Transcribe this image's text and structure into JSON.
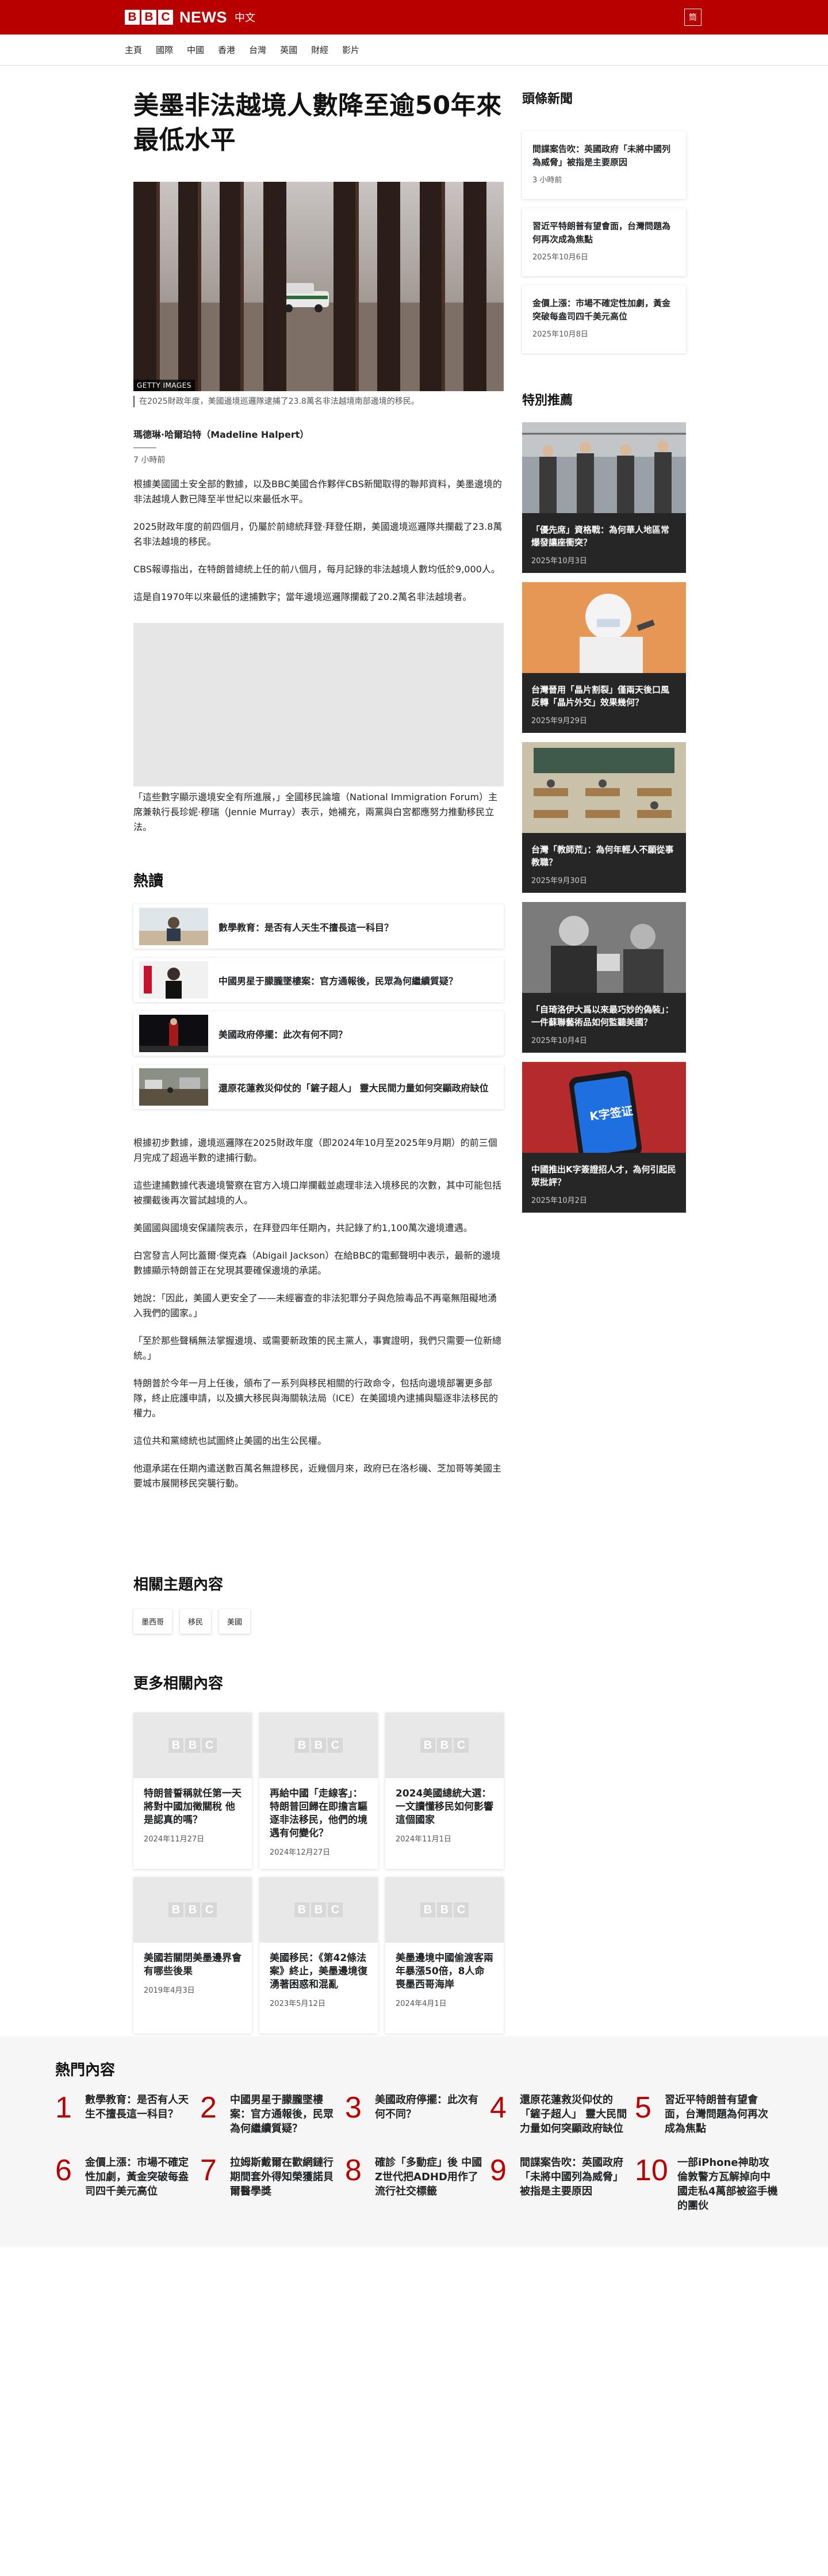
{
  "header": {
    "logo_letters": [
      "B",
      "B",
      "C"
    ],
    "logo_news": "NEWS",
    "language": "中文",
    "menu_label": "筒"
  },
  "nav": [
    "主頁",
    "國際",
    "中國",
    "香港",
    "台灣",
    "英國",
    "財經",
    "影片"
  ],
  "article": {
    "headline": "美墨非法越境人數降至逾50年來最低水平",
    "hero_credit": "GETTY IMAGES",
    "caption": "在2025財政年度，美國邊境巡邏隊逮捕了23.8萬名非法越境南部邊境的移民。",
    "author": "瑪德琳·哈爾珀特（Madeline Halpert）",
    "time": "7 小時前",
    "paragraphs": [
      "根據美國國土安全部的數據，以及BBC美國合作夥伴CBS新聞取得的聯邦資料，美墨邊境的非法越境人數已降至半世紀以來最低水平。",
      "2025財政年度的前四個月，仍屬於前總統拜登·拜登任期，美國邊境巡邏隊共攔截了23.8萬名非法越境的移民。",
      "CBS報導指出，在特朗普總統上任的前八個月，每月記錄的非法越境人數均低於9,000人。",
      "這是自1970年以來最低的逮捕數字；當年邊境巡邏隊攔截了20.2萬名非法越境者。"
    ],
    "quote_paragraph": "「這些數字顯示邊境安全有所進展，」全國移民論壇（National Immigration Forum）主席兼執行長珍妮·穆瑞（Jennie Murray）表示，她補充，兩黨與白宮都應努力推動移民立法。",
    "paragraphs2": [
      "根據初步數據，邊境巡邏隊在2025財政年度（即2024年10月至2025年9月期）的前三個月完成了超過半數的逮捕行動。",
      "這些逮捕數據代表邊境警察在官方入境口岸攔截並處理非法入境移民的次數，其中可能包括被攔截後再次嘗試越境的人。",
      "美國國與國境安保議院表示，在拜登四年任期內，共記錄了約1,100萬次邊境遭遇。",
      "白宮發言人阿比蓋爾·傑克森（Abigail Jackson）在給BBC的電郵聲明中表示，最新的邊境數據顯示特朗普正在兌現其要確保邊境的承諾。",
      "她說：「因此，美國人更安全了——未經審查的非法犯罪分子與危險毒品不再毫無阻礙地湧入我們的國家。」",
      "「至於那些聲稱無法掌握邊境、或需要新政策的民主黨人，事實證明，我們只需要一位新總統。」",
      "特朗普於今年一月上任後，頒布了一系列與移民相關的行政命令，包括向邊境部署更多部隊，終止庇護申請，以及擴大移民與海關執法局（ICE）在美國境內逮捕與驅逐非法移民的權力。",
      "這位共和黨總統也試圖終止美國的出生公民權。",
      "他還承諾在任期內遣送數百萬名無證移民，近幾個月來，政府已在洛杉磯、芝加哥等美國主要城市展開移民突襲行動。"
    ]
  },
  "hot_reads": {
    "title": "熱讀",
    "items": [
      "數學教育：是否有人天生不擅長這一科目？",
      "中國男星于朦朧墜樓案：官方通報後，民眾為何繼續質疑？",
      "美國政府停擺：此次有何不同？",
      "還原花蓮救災仰仗的「鏟子超人」 靈大民間力量如何突顯政府缺位"
    ]
  },
  "related_topics": {
    "title": "相關主題內容",
    "tags": [
      "墨西哥",
      "移民",
      "美國"
    ]
  },
  "more": {
    "title": "更多相關內容",
    "cards": [
      {
        "title": "特朗普誓稱就任第一天將對中國加徵關稅 他是認真的嗎？",
        "date": "2024年11月27日"
      },
      {
        "title": "再給中國「走線客」：特朗普回歸在即擔言驅逐非法移民，他們的境遇有何變化？",
        "date": "2024年12月27日"
      },
      {
        "title": "2024美國總統大選：一文讀懂移民如何影響這個國家",
        "date": "2024年11月1日"
      },
      {
        "title": "美國若關閉美墨邊界會有哪些後果",
        "date": "2019年4月3日"
      },
      {
        "title": "美國移民：《第42條法案》終止，美墨邊境復湧著困惑和混亂",
        "date": "2023年5月12日"
      },
      {
        "title": "美墨邊境中國偷渡客兩年暴漲50倍，8人命喪墨西哥海岸",
        "date": "2024年4月1日"
      }
    ]
  },
  "popular": {
    "title": "熱門內容",
    "items": [
      {
        "num": "1",
        "text": "數學教育：是否有人天生不擅長這一科目？"
      },
      {
        "num": "2",
        "text": "中國男星于朦朧墜樓案：官方通報後，民眾為何繼續質疑？"
      },
      {
        "num": "3",
        "text": "美國政府停擺：此次有何不同？"
      },
      {
        "num": "4",
        "text": "還原花蓮救災仰仗的「鏟子超人」 靈大民間力量如何突顯政府缺位"
      },
      {
        "num": "5",
        "text": "習近平特朗普有望會面，台灣問題為何再次成為焦點"
      },
      {
        "num": "6",
        "text": "金價上漲：市場不確定性加劇，黃金突破每盎司四千美元高位"
      },
      {
        "num": "7",
        "text": "拉姆斯戴爾在歡網鏈行期間套外得知榮獲諾貝爾醫學獎"
      },
      {
        "num": "8",
        "text": "確診「多動症」後 中國Z世代把ADHD用作了流行社交標籤"
      },
      {
        "num": "9",
        "text": "間諜案告吹：英國政府「未將中國列為威脅」被指是主要原因"
      },
      {
        "num": "10",
        "text": "一部iPhone神助攻 倫敦警方瓦解掉向中國走私4萬部被盜手機的團伙"
      }
    ]
  },
  "sidebar": {
    "news_title": "頭條新聞",
    "news": [
      {
        "title": "間諜案告吹：英國政府「未將中國列為威脅」被指是主要原因",
        "date": "3 小時前"
      },
      {
        "title": "習近平特朗普有望會面，台灣問題為何再次成為焦點",
        "date": "2025年10月6日"
      },
      {
        "title": "金價上漲：市場不確定性加劇，黃金突破每盎司四千美元高位",
        "date": "2025年10月8日"
      }
    ],
    "special_title": "特別推薦",
    "features": [
      {
        "title": "「優先席」資格戰：為何華人地區常爆發讓座衝突？",
        "date": "2025年10月3日"
      },
      {
        "title": "台灣晉用「晶片割裂」僅兩天後口風反轉「晶片外交」效果幾何？",
        "date": "2025年9月29日"
      },
      {
        "title": "台灣「教師荒」：為何年輕人不願從事教職？",
        "date": "2025年9月30日"
      },
      {
        "title": "「自琦洛伊大爲以來最巧妙的偽裝」：一件蘇聯藝術品如何監聽美國？",
        "date": "2025年10月4日"
      },
      {
        "title": "中國推出K字簽證招人才，為何引起民眾批評？",
        "date": "2025年10月2日"
      }
    ],
    "k_visa_screen_text": "K字签证"
  }
}
